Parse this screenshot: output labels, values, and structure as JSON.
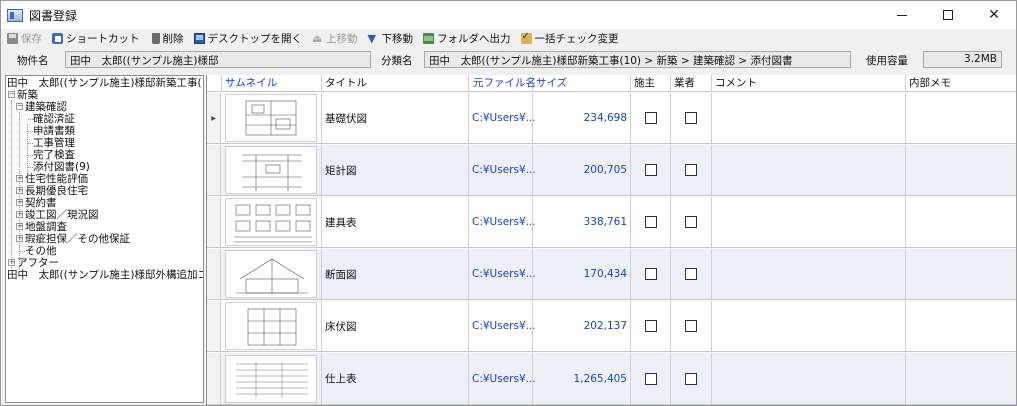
{
  "window": {
    "title": "図書登録"
  },
  "toolbar": {
    "save": "保存",
    "shortcut": "ショートカット",
    "delete": "削除",
    "open_desktop": "デスクトップを開く",
    "move_up": "上移動",
    "move_down": "下移動",
    "output_folder": "フォルダへ出力",
    "bulk_check": "一括チェック変更"
  },
  "info": {
    "property_label": "物件名",
    "property_value": "田中　太郎((サンプル施主)様邸",
    "category_label": "分類名",
    "category_value": "田中　太郎((サンプル施主)様邸新築工事(10) > 新築 > 建築確認 > 添付図書",
    "usage_label": "使用容量",
    "usage_value": "3.2MB"
  },
  "tree": {
    "items": [
      {
        "label": "田中　太郎((サンプル施主)様邸新築工事("
      },
      {
        "label": "新築"
      },
      {
        "label": "建築確認"
      },
      {
        "label": "確認済証"
      },
      {
        "label": "申請書類"
      },
      {
        "label": "工事管理"
      },
      {
        "label": "完了検査"
      },
      {
        "label": "添付図書(9)"
      },
      {
        "label": "住宅性能評価"
      },
      {
        "label": "長期優良住宅"
      },
      {
        "label": "契約書"
      },
      {
        "label": "竣工図／現況図"
      },
      {
        "label": "地盤調査"
      },
      {
        "label": "瑕疵担保／その他保証"
      },
      {
        "label": "その他"
      },
      {
        "label": "アフター"
      },
      {
        "label": "田中　太郎((サンプル施主)様邸外構追加コ"
      }
    ]
  },
  "grid": {
    "columns": {
      "thumbnail": "サムネイル",
      "title": "タイトル",
      "source_file": "元ファイル名",
      "size": "サイズ",
      "owner": "施主",
      "vendor": "業者",
      "comment": "コメント",
      "memo": "内部メモ"
    },
    "rows": [
      {
        "title": "基礎伏図",
        "source_file": "C:¥Users¥...",
        "size": "234,698"
      },
      {
        "title": "矩計図",
        "source_file": "C:¥Users¥...",
        "size": "200,705"
      },
      {
        "title": "建具表",
        "source_file": "C:¥Users¥...",
        "size": "338,761"
      },
      {
        "title": "断面図",
        "source_file": "C:¥Users¥...",
        "size": "170,434"
      },
      {
        "title": "床伏図",
        "source_file": "C:¥Users¥...",
        "size": "202,137"
      },
      {
        "title": "仕上表",
        "source_file": "C:¥Users¥...",
        "size": "1,265,405"
      }
    ]
  }
}
